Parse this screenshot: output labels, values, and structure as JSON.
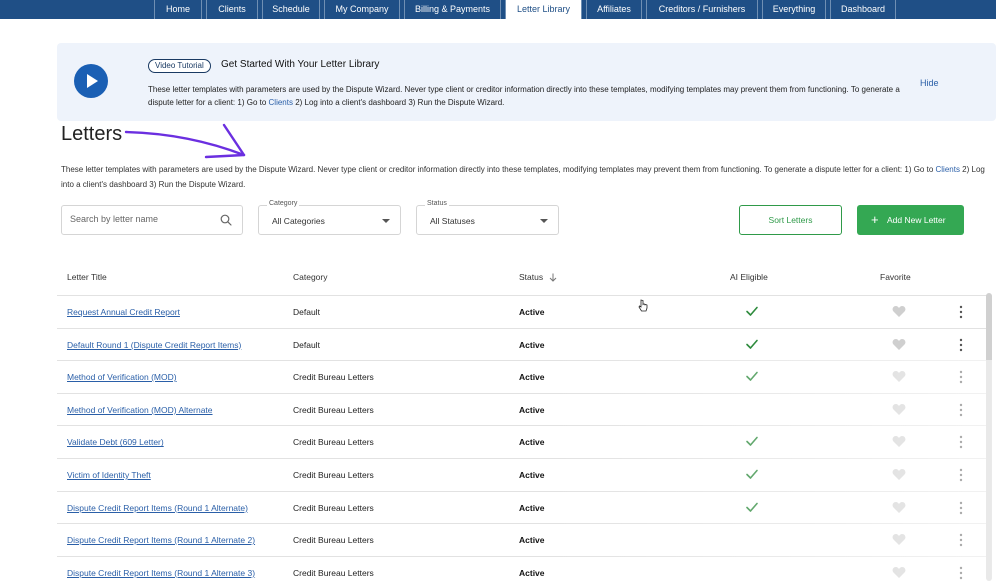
{
  "nav": {
    "tabs": [
      {
        "label": "Home",
        "active": false
      },
      {
        "label": "Clients",
        "active": false
      },
      {
        "label": "Schedule",
        "active": false
      },
      {
        "label": "My Company",
        "active": false
      },
      {
        "label": "Billing & Payments",
        "active": false
      },
      {
        "label": "Letter Library",
        "active": true
      },
      {
        "label": "Affiliates",
        "active": false
      },
      {
        "label": "Creditors / Furnishers",
        "active": false
      },
      {
        "label": "Everything",
        "active": false
      },
      {
        "label": "Dashboard",
        "active": false
      }
    ]
  },
  "banner": {
    "badge": "Video Tutorial",
    "title": "Get Started With Your Letter Library",
    "text_before_link": "These letter templates with parameters are used by the Dispute Wizard. Never type client or creditor information directly into these templates, modifying templates may prevent them from functioning. To generate a dispute letter for a client: 1) Go to ",
    "link": "Clients",
    "text_after_link": " 2) Log into a client's dashboard 3) Run the Dispute Wizard.",
    "hide": "Hide"
  },
  "page": {
    "title": "Letters",
    "desc_before_link": "These letter templates with parameters are used by the Dispute Wizard. Never type client or creditor information directly into these templates, modifying templates may prevent them from functioning. To generate a dispute letter for a client: 1) Go to ",
    "desc_link": "Clients",
    "desc_after_link": " 2) Log into a client's dashboard 3) Run the Dispute Wizard."
  },
  "filters": {
    "search_placeholder": "Search by letter name",
    "category_label": "Category",
    "category_value": "All Categories",
    "status_label": "Status",
    "status_value": "All Statuses",
    "sort_button": "Sort Letters",
    "add_button": "Add New Letter"
  },
  "table": {
    "headers": {
      "title": "Letter Title",
      "category": "Category",
      "status": "Status",
      "ai": "AI Eligible",
      "favorite": "Favorite"
    },
    "rows": [
      {
        "title": "Request Annual Credit Report",
        "category": "Default",
        "status": "Active",
        "ai": true
      },
      {
        "title": "Default Round 1 (Dispute Credit Report Items)",
        "category": "Default",
        "status": "Active",
        "ai": true
      },
      {
        "title": "Method of Verification (MOD)",
        "category": "Credit Bureau Letters",
        "status": "Active",
        "ai": true
      },
      {
        "title": "Method of Verification (MOD) Alternate",
        "category": "Credit Bureau Letters",
        "status": "Active",
        "ai": false
      },
      {
        "title": "Validate Debt (609 Letter)",
        "category": "Credit Bureau Letters",
        "status": "Active",
        "ai": true
      },
      {
        "title": "Victim of Identity Theft",
        "category": "Credit Bureau Letters",
        "status": "Active",
        "ai": true
      },
      {
        "title": "Dispute Credit Report Items (Round 1 Alternate)",
        "category": "Credit Bureau Letters",
        "status": "Active",
        "ai": true
      },
      {
        "title": "Dispute Credit Report Items (Round 1 Alternate 2)",
        "category": "Credit Bureau Letters",
        "status": "Active",
        "ai": false
      },
      {
        "title": "Dispute Credit Report Items (Round 1 Alternate 3)",
        "category": "Credit Bureau Letters",
        "status": "Active",
        "ai": false
      }
    ]
  },
  "colors": {
    "nav": "#1f4f86",
    "link": "#2a5fa8",
    "green": "#34a853",
    "annotation": "#6b2fe0"
  }
}
